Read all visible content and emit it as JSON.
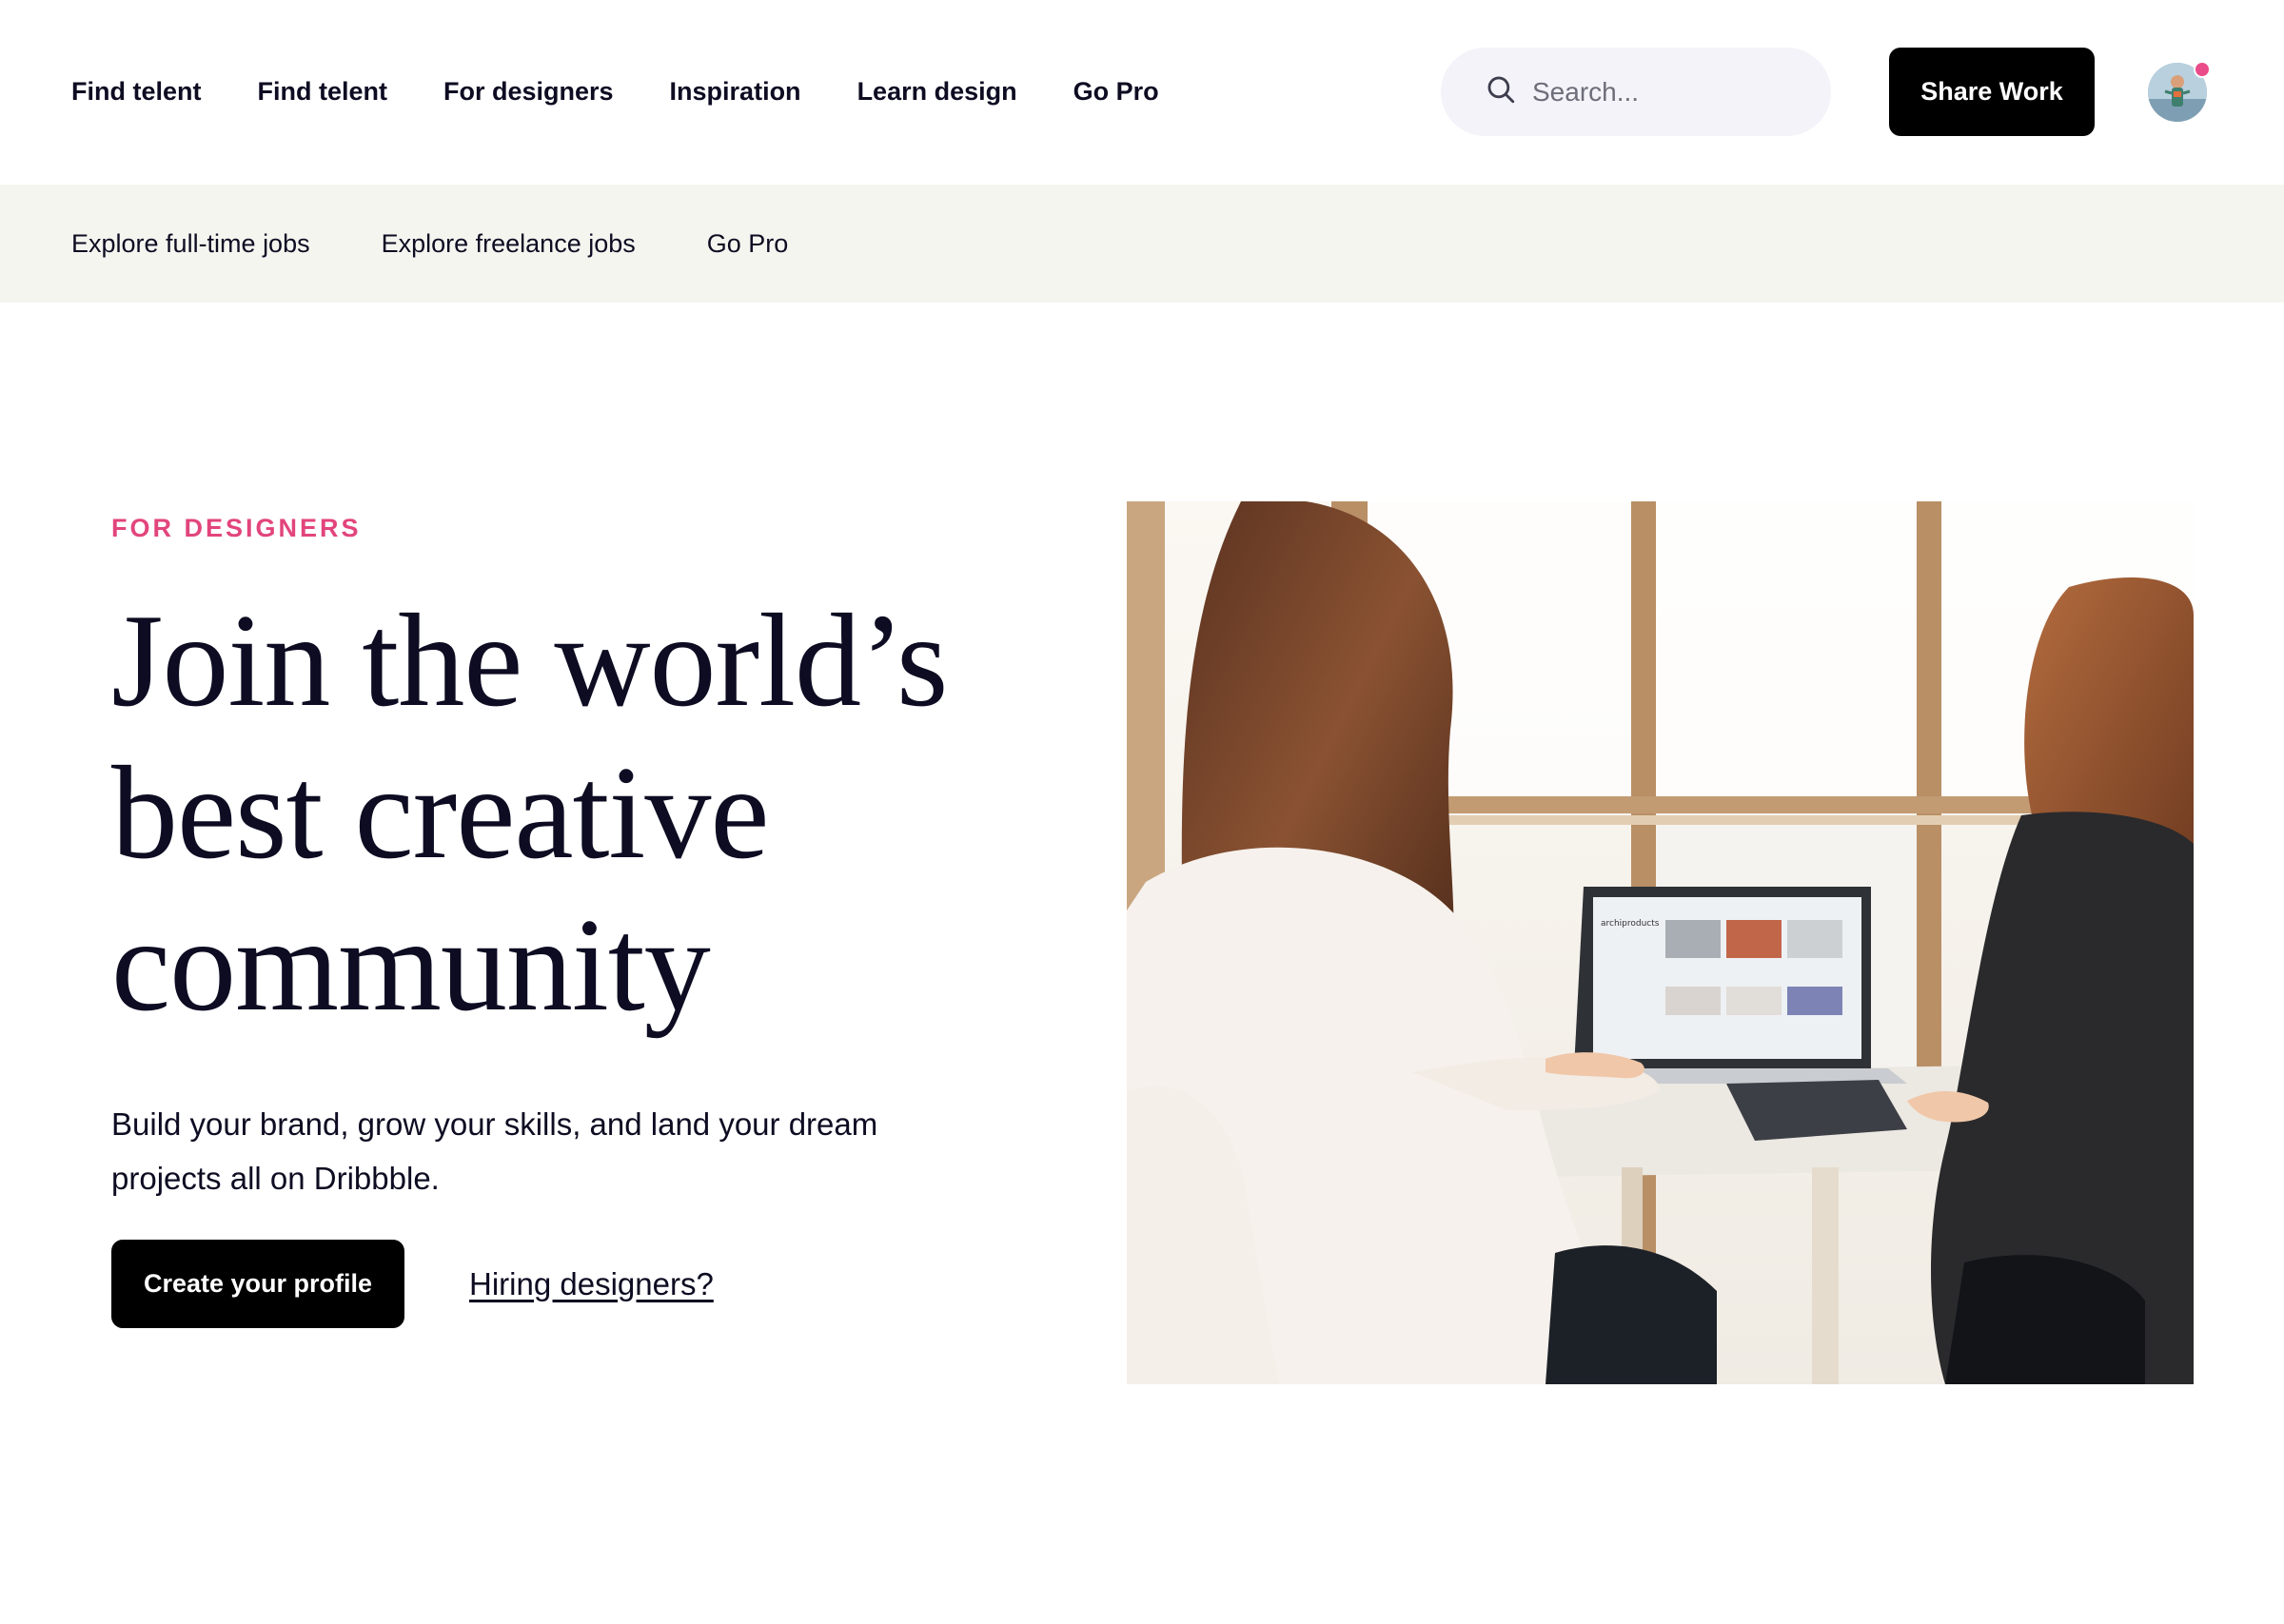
{
  "header": {
    "nav": [
      "Find telent",
      "Find telent",
      "For designers",
      "Inspiration",
      "Learn design",
      "Go Pro"
    ],
    "search": {
      "placeholder": "Search..."
    },
    "share_label": "Share Work",
    "avatar_icon": "user-avatar",
    "notification_color": "#ea4c89"
  },
  "subnav": {
    "items": [
      "Explore full-time jobs",
      "Explore freelance jobs",
      "Go Pro"
    ]
  },
  "hero": {
    "eyebrow": "FOR DESIGNERS",
    "headline": [
      "Join the world’s",
      "best creative",
      "community"
    ],
    "subtitle": "Build your brand, grow your skills, and land your dream projects all on Dribbble.",
    "cta_label": "Create your profile",
    "hiring_label": "Hiring designers?",
    "eyebrow_color": "#e2457c",
    "photo_laptop_text": "archiproducts"
  }
}
